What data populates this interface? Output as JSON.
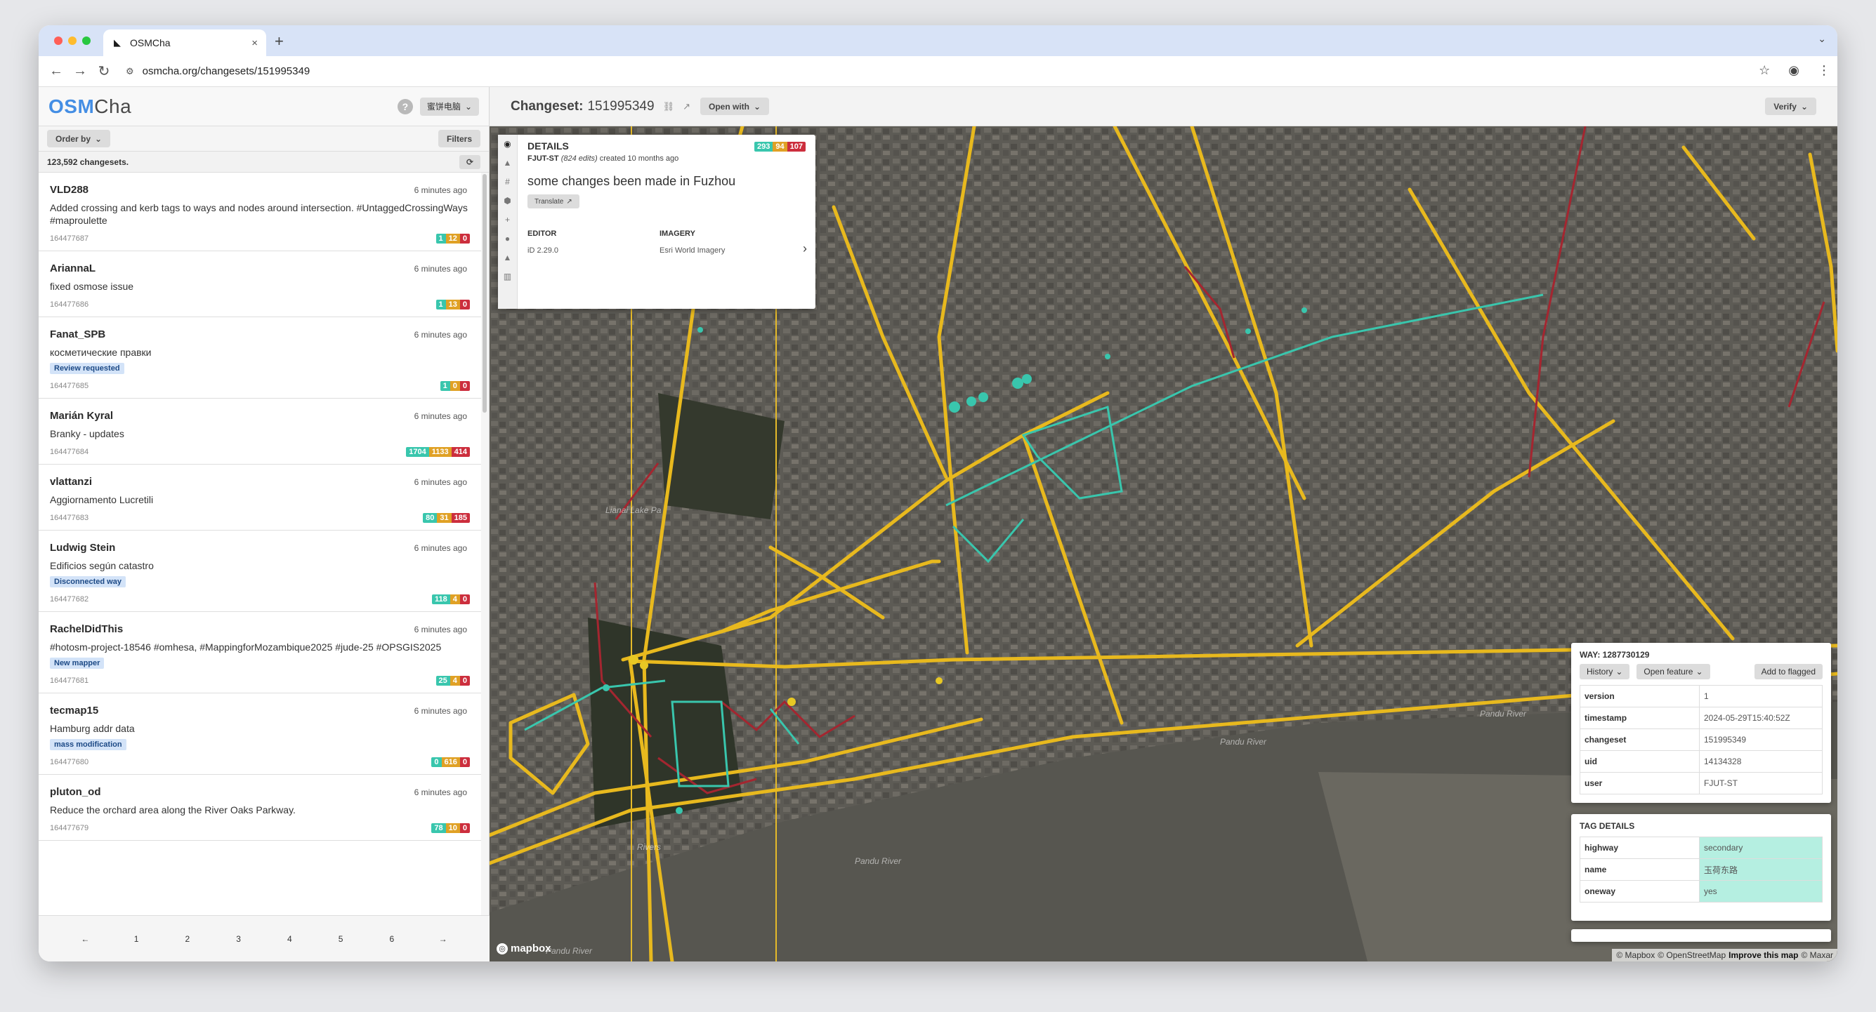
{
  "browser": {
    "tab_title": "OSMCha",
    "url": "osmcha.org/changesets/151995349"
  },
  "sidebar": {
    "logo_osm": "OSM",
    "logo_cha": "Cha",
    "user_button": "蜜饼电脑",
    "order_by": "Order by",
    "filters": "Filters",
    "changeset_count": "123,592 changesets.",
    "changesets": [
      {
        "user": "VLD288",
        "time": "6 minutes ago",
        "comment": "Added crossing and kerb tags to ways and nodes around intersection. #UntaggedCrossingWays #maproulette",
        "tag": "",
        "id": "164477687",
        "add": "1",
        "mod": "12",
        "del": "0"
      },
      {
        "user": "AriannaL",
        "time": "6 minutes ago",
        "comment": "fixed osmose issue",
        "tag": "",
        "id": "164477686",
        "add": "1",
        "mod": "13",
        "del": "0"
      },
      {
        "user": "Fanat_SPB",
        "time": "6 minutes ago",
        "comment": "косметические правки",
        "tag": "Review requested",
        "id": "164477685",
        "add": "1",
        "mod": "0",
        "del": "0"
      },
      {
        "user": "Marián Kyral",
        "time": "6 minutes ago",
        "comment": "Branky - updates",
        "tag": "",
        "id": "164477684",
        "add": "1704",
        "mod": "1133",
        "del": "414"
      },
      {
        "user": "vlattanzi",
        "time": "6 minutes ago",
        "comment": "Aggiornamento Lucretili",
        "tag": "",
        "id": "164477683",
        "add": "80",
        "mod": "31",
        "del": "185"
      },
      {
        "user": "Ludwig Stein",
        "time": "6 minutes ago",
        "comment": "Edificios según catastro",
        "tag": "Disconnected way",
        "id": "164477682",
        "add": "118",
        "mod": "4",
        "del": "0"
      },
      {
        "user": "RachelDidThis",
        "time": "6 minutes ago",
        "comment": "#hotosm-project-18546 #omhesa, #MappingforMozambique2025 #jude-25 #OPSGIS2025",
        "tag": "New mapper",
        "id": "164477681",
        "add": "25",
        "mod": "4",
        "del": "0"
      },
      {
        "user": "tecmap15",
        "time": "6 minutes ago",
        "comment": "Hamburg addr data",
        "tag": "mass modification",
        "id": "164477680",
        "add": "0",
        "mod": "616",
        "del": "0"
      },
      {
        "user": "pluton_od",
        "time": "6 minutes ago",
        "comment": "Reduce the orchard area along the River Oaks Parkway.",
        "tag": "",
        "id": "164477679",
        "add": "78",
        "mod": "10",
        "del": "0"
      }
    ],
    "pagination": [
      "←",
      "1",
      "2",
      "3",
      "4",
      "5",
      "6",
      "→"
    ]
  },
  "main": {
    "title_label": "Changeset:",
    "changeset_id": "151995349",
    "open_with": "Open with",
    "verify": "Verify"
  },
  "details": {
    "title": "DETAILS",
    "add": "293",
    "mod": "94",
    "del": "107",
    "user": "FJUT-ST",
    "edits": "(824 edits)",
    "created": "created 10 months ago",
    "comment": "some changes been made in Fuzhou",
    "translate": "Translate",
    "editor_label": "EDITOR",
    "editor_value": "iD 2.29.0",
    "imagery_label": "IMAGERY",
    "imagery_value": "Esri World Imagery"
  },
  "way_panel": {
    "title": "WAY: 1287730129",
    "history": "History",
    "open_feature": "Open feature",
    "add_flagged": "Add to flagged",
    "rows": [
      {
        "k": "version",
        "v": "1"
      },
      {
        "k": "timestamp",
        "v": "2024-05-29T15:40:52Z"
      },
      {
        "k": "changeset",
        "v": "151995349"
      },
      {
        "k": "uid",
        "v": "14134328"
      },
      {
        "k": "user",
        "v": "FJUT-ST"
      }
    ]
  },
  "tag_panel": {
    "title": "TAG DETAILS",
    "rows": [
      {
        "k": "highway",
        "v": "secondary"
      },
      {
        "k": "name",
        "v": "玉荷东路"
      },
      {
        "k": "oneway",
        "v": "yes"
      }
    ]
  },
  "map": {
    "labels": [
      "Lianai Lake Pa",
      "Pandu River",
      "Pandu River",
      "Rivers",
      "Pandu River",
      "Pandu River"
    ],
    "mapbox": "mapbox",
    "attribution_mapbox": "© Mapbox",
    "attribution_osm": "© OpenStreetMap",
    "improve": "Improve this map",
    "attribution_maxar": "© Maxar"
  },
  "colors": {
    "added": "#39c6ad",
    "modified": "#e0a125",
    "deleted": "#cc2e3d",
    "brand": "#448ee4"
  }
}
